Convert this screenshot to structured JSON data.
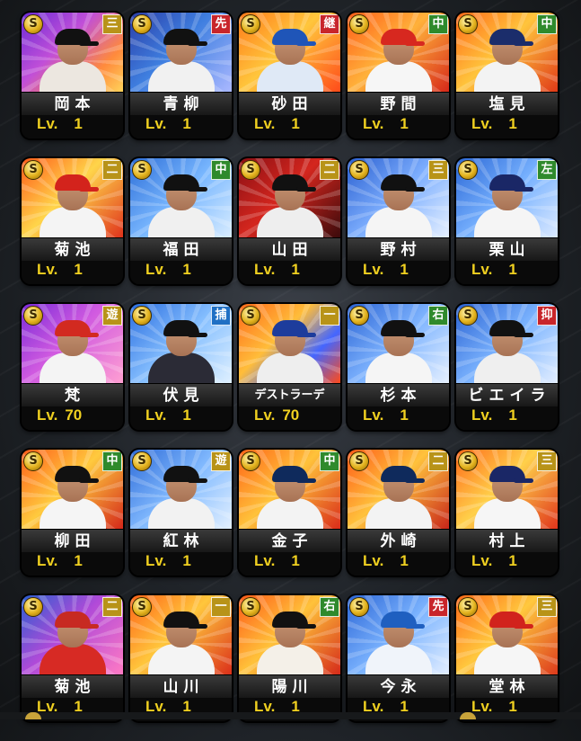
{
  "colors": {
    "pos_red": "#c8252b",
    "pos_green": "#2f8a2c",
    "pos_gold": "#b89318",
    "pos_blue": "#1f6fc4",
    "level_yellow": "#f0d020"
  },
  "cards": [
    {
      "name": "岡本",
      "position": "三",
      "pos_color": "#b89318",
      "level_prefix": "Lv.",
      "level": "1",
      "bg": "linear-gradient(135deg,#6a2bd6,#c14fd8 40%,#ff8a3c 75%,#ffd35a)",
      "cap": "#111",
      "body": "#ece7e0"
    },
    {
      "name": "青柳",
      "position": "先",
      "pos_color": "#c8252b",
      "level_prefix": "Lv.",
      "level": "1",
      "bg": "linear-gradient(135deg,#2a3ea8,#3f7fe0 45%,#aab8ff)",
      "cap": "#111",
      "body": "#f1f1f1"
    },
    {
      "name": "砂田",
      "position": "継",
      "pos_color": "#c8252b",
      "level_prefix": "Lv.",
      "level": "1",
      "bg": "linear-gradient(135deg,#ff7a1a,#ffc63c 45%,#ff4b1a)",
      "cap": "#1f55b8",
      "body": "#dfe9f6"
    },
    {
      "name": "野間",
      "position": "中",
      "pos_color": "#2f8a2c",
      "level_prefix": "Lv.",
      "level": "1",
      "bg": "linear-gradient(135deg,#ff5e1a,#ffb13a 45%,#d7291a)",
      "cap": "#d7281f",
      "body": "#f6f6f6"
    },
    {
      "name": "塩見",
      "position": "中",
      "pos_color": "#2f8a2c",
      "level_prefix": "Lv.",
      "level": "1",
      "bg": "linear-gradient(135deg,#ff6a1a,#ffc43c 45%,#e03a18)",
      "cap": "#1b2d6b",
      "body": "#f3f3f3"
    },
    {
      "name": "菊池",
      "position": "二",
      "pos_color": "#b89318",
      "level_prefix": "Lv.",
      "level": "1",
      "bg": "linear-gradient(135deg,#ff5a1a,#ffd54a 45%,#e0331c)",
      "cap": "#d3231c",
      "body": "#f4f4f4"
    },
    {
      "name": "福田",
      "position": "中",
      "pos_color": "#2f8a2c",
      "level_prefix": "Lv.",
      "level": "1",
      "bg": "linear-gradient(135deg,#2d6ed8,#7ab8ff 50%,#d8ecff)",
      "cap": "#111",
      "body": "#f0f0f0"
    },
    {
      "name": "山田",
      "position": "二",
      "pos_color": "#b89318",
      "level_prefix": "Lv.",
      "level": "1",
      "bg": "linear-gradient(135deg,#8a0f14,#d4261e 45%,#3b0a0b)",
      "cap": "#111",
      "body": "#eeeeee"
    },
    {
      "name": "野村",
      "position": "三",
      "pos_color": "#b89318",
      "level_prefix": "Lv.",
      "level": "1",
      "bg": "linear-gradient(135deg,#2a5fd0,#7fb0ff 50%,#e6f0ff)",
      "cap": "#111",
      "body": "#f5f5f5"
    },
    {
      "name": "栗山",
      "position": "左",
      "pos_color": "#2f8a2c",
      "level_prefix": "Lv.",
      "level": "1",
      "bg": "linear-gradient(135deg,#2c68d6,#78b2ff 50%,#dbe9ff)",
      "cap": "#1a2766",
      "body": "#f5f5f5"
    },
    {
      "name": "梵",
      "position": "遊",
      "pos_color": "#b89318",
      "level_prefix": "Lv.",
      "level": "70",
      "bg": "linear-gradient(135deg,#7a2bd8,#d05ae0 45%,#ff9fd2)",
      "cap": "#d22a20",
      "body": "#f4f4f4"
    },
    {
      "name": "伏見",
      "position": "捕",
      "pos_color": "#1f6fc4",
      "level_prefix": "Lv.",
      "level": "1",
      "bg": "linear-gradient(135deg,#2b6ee0,#87c0ff 50%,#dff0ff)",
      "cap": "#111",
      "body": "#2b2b36"
    },
    {
      "name": "デストラーデ",
      "position": "一",
      "pos_color": "#b89318",
      "level_prefix": "Lv.",
      "level": "70",
      "bg": "linear-gradient(135deg,#ff6a1a,#ffbd3a 40%,#4466ff 70%,#ff4a1a)",
      "cap": "#1d3c9c",
      "body": "#eeeeee"
    },
    {
      "name": "杉本",
      "position": "右",
      "pos_color": "#2f8a2c",
      "level_prefix": "Lv.",
      "level": "1",
      "bg": "linear-gradient(135deg,#2a63d4,#80b5ff 50%,#e6f0ff)",
      "cap": "#111",
      "body": "#f5f5f5"
    },
    {
      "name": "ビエイラ",
      "position": "抑",
      "pos_color": "#c8252b",
      "level_prefix": "Lv.",
      "level": "1",
      "bg": "linear-gradient(135deg,#2a62d2,#7cb4ff 50%,#e3eeff)",
      "cap": "#111",
      "body": "#efefef"
    },
    {
      "name": "柳田",
      "position": "中",
      "pos_color": "#2f8a2c",
      "level_prefix": "Lv.",
      "level": "1",
      "bg": "linear-gradient(135deg,#ff5c1a,#ffca3e 45%,#d4281a)",
      "cap": "#111",
      "body": "#f5f5f5"
    },
    {
      "name": "紅林",
      "position": "遊",
      "pos_color": "#b89318",
      "level_prefix": "Lv.",
      "level": "1",
      "bg": "linear-gradient(135deg,#2e6bd8,#83bbff 50%,#e3f0ff)",
      "cap": "#111",
      "body": "#f2f2f2"
    },
    {
      "name": "金子",
      "position": "中",
      "pos_color": "#2f8a2c",
      "level_prefix": "Lv.",
      "level": "1",
      "bg": "linear-gradient(135deg,#ff6418,#ffc23a 45%,#d92c1a)",
      "cap": "#0f2a5c",
      "body": "#f3f3f3"
    },
    {
      "name": "外崎",
      "position": "二",
      "pos_color": "#b89318",
      "level_prefix": "Lv.",
      "level": "1",
      "bg": "linear-gradient(135deg,#ff5a18,#ffc23c 45%,#c8261a)",
      "cap": "#0f2a5c",
      "body": "#f3f3f3"
    },
    {
      "name": "村上",
      "position": "三",
      "pos_color": "#b89318",
      "level_prefix": "Lv.",
      "level": "1",
      "bg": "linear-gradient(135deg,#ff6a1a,#ffd04a 45%,#e0351c)",
      "cap": "#1a2766",
      "body": "#f6f6f6"
    },
    {
      "name": "菊池",
      "position": "二",
      "pos_color": "#b89318",
      "level_prefix": "Lv.",
      "level": "1",
      "bg": "linear-gradient(135deg,#2a5fd0,#b04ad8 45%,#ff7ac4)",
      "cap": "#c72a22",
      "body": "#d72a24"
    },
    {
      "name": "山川",
      "position": "一",
      "pos_color": "#b89318",
      "level_prefix": "Lv.",
      "level": "1",
      "bg": "linear-gradient(135deg,#ff6418,#ffc63c 45%,#db2f1a)",
      "cap": "#111",
      "body": "#f4f4f4"
    },
    {
      "name": "陽川",
      "position": "右",
      "pos_color": "#2f8a2c",
      "level_prefix": "Lv.",
      "level": "1",
      "bg": "linear-gradient(135deg,#ff5a18,#ffc23a 45%,#d52a1a)",
      "cap": "#111",
      "body": "#f4f0e8"
    },
    {
      "name": "今永",
      "position": "先",
      "pos_color": "#c8252b",
      "level_prefix": "Lv.",
      "level": "1",
      "bg": "linear-gradient(135deg,#2c66d6,#7cb4ff 50%,#e3eeff)",
      "cap": "#1f5fc0",
      "body": "#f0f4fa"
    },
    {
      "name": "堂林",
      "position": "三",
      "pos_color": "#b89318",
      "level_prefix": "Lv.",
      "level": "1",
      "bg": "linear-gradient(135deg,#ff6a18,#ffc83e 45%,#dd3a1c)",
      "cap": "#d1231c",
      "body": "#f6f6f6"
    }
  ]
}
